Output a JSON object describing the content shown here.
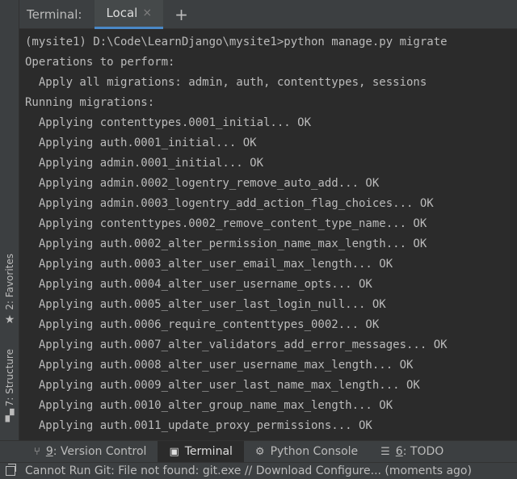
{
  "tool_window": {
    "title": "Terminal:",
    "tab_label": "Local",
    "close_glyph": "×",
    "new_tab_glyph": "+"
  },
  "side_tabs": {
    "favorites": {
      "label": "2: Favorites",
      "icon": "star-icon"
    },
    "structure": {
      "label": "7: Structure",
      "icon": "structure-icon"
    }
  },
  "terminal_lines": [
    "(mysite1) D:\\Code\\LearnDjango\\mysite1>python manage.py migrate",
    "Operations to perform:",
    "  Apply all migrations: admin, auth, contenttypes, sessions",
    "Running migrations:",
    "  Applying contenttypes.0001_initial... OK",
    "  Applying auth.0001_initial... OK",
    "  Applying admin.0001_initial... OK",
    "  Applying admin.0002_logentry_remove_auto_add... OK",
    "  Applying admin.0003_logentry_add_action_flag_choices... OK",
    "  Applying contenttypes.0002_remove_content_type_name... OK",
    "  Applying auth.0002_alter_permission_name_max_length... OK",
    "  Applying auth.0003_alter_user_email_max_length... OK",
    "  Applying auth.0004_alter_user_username_opts... OK",
    "  Applying auth.0005_alter_user_last_login_null... OK",
    "  Applying auth.0006_require_contenttypes_0002... OK",
    "  Applying auth.0007_alter_validators_add_error_messages... OK",
    "  Applying auth.0008_alter_user_username_max_length... OK",
    "  Applying auth.0009_alter_user_last_name_max_length... OK",
    "  Applying auth.0010_alter_group_name_max_length... OK",
    "  Applying auth.0011_update_proxy_permissions... OK"
  ],
  "bottom_toolbar": {
    "version_control": {
      "prefix": "9",
      "label": ": Version Control",
      "icon": "version-control-icon"
    },
    "terminal": {
      "label": "Terminal",
      "icon": "terminal-icon"
    },
    "python_console": {
      "label": "Python Console",
      "icon": "python-icon"
    },
    "todo": {
      "prefix": "6",
      "label": ": TODO",
      "icon": "list-icon"
    }
  },
  "status_bar": {
    "message": "Cannot Run Git: File not found: git.exe // Download   Configure... (moments ago)",
    "icon": "event-log-icon"
  },
  "colors": {
    "background": "#2b2b2b",
    "panel": "#3c3f41",
    "text": "#bbbbbb",
    "accent": "#4a88c7"
  }
}
